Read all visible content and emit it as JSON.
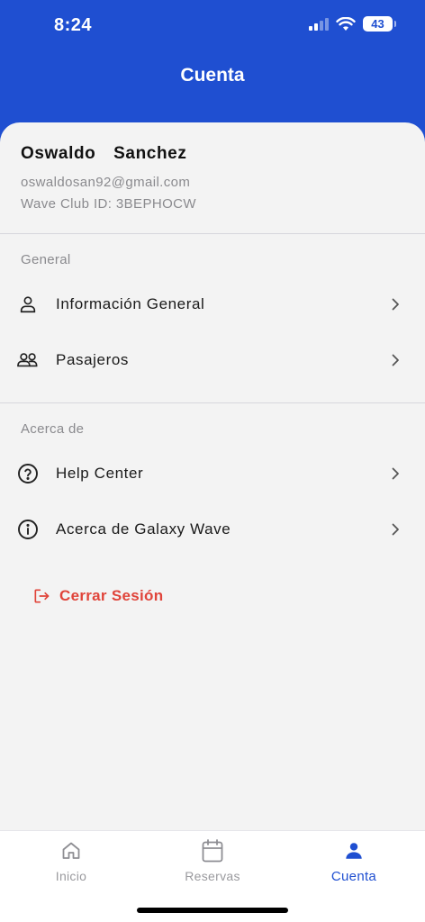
{
  "status_bar": {
    "time": "8:24",
    "battery": "43"
  },
  "header": {
    "title": "Cuenta"
  },
  "profile": {
    "name": "Oswaldo  Sanchez",
    "email": "oswaldosan92@gmail.com",
    "club_id": "Wave Club ID: 3BEPHOCW"
  },
  "sections": {
    "general": {
      "label": "General",
      "items": [
        {
          "label": "Información General",
          "icon": "person-icon"
        },
        {
          "label": "Pasajeros",
          "icon": "people-icon"
        }
      ]
    },
    "about": {
      "label": "Acerca de",
      "items": [
        {
          "label": "Help Center",
          "icon": "help-circle-icon"
        },
        {
          "label": "Acerca de Galaxy Wave",
          "icon": "info-circle-icon"
        }
      ]
    }
  },
  "logout": {
    "label": "Cerrar Sesión",
    "icon": "logout-icon",
    "color": "#e0443a"
  },
  "tabbar": {
    "tabs": [
      {
        "label": "Inicio",
        "icon": "home-icon"
      },
      {
        "label": "Reservas",
        "icon": "calendar-icon"
      },
      {
        "label": "Cuenta",
        "icon": "person-filled-icon",
        "active": true
      }
    ]
  },
  "colors": {
    "primary": "#1f4fd1",
    "background": "#f3f3f3",
    "muted": "#8a8a8e",
    "danger": "#e0443a"
  }
}
